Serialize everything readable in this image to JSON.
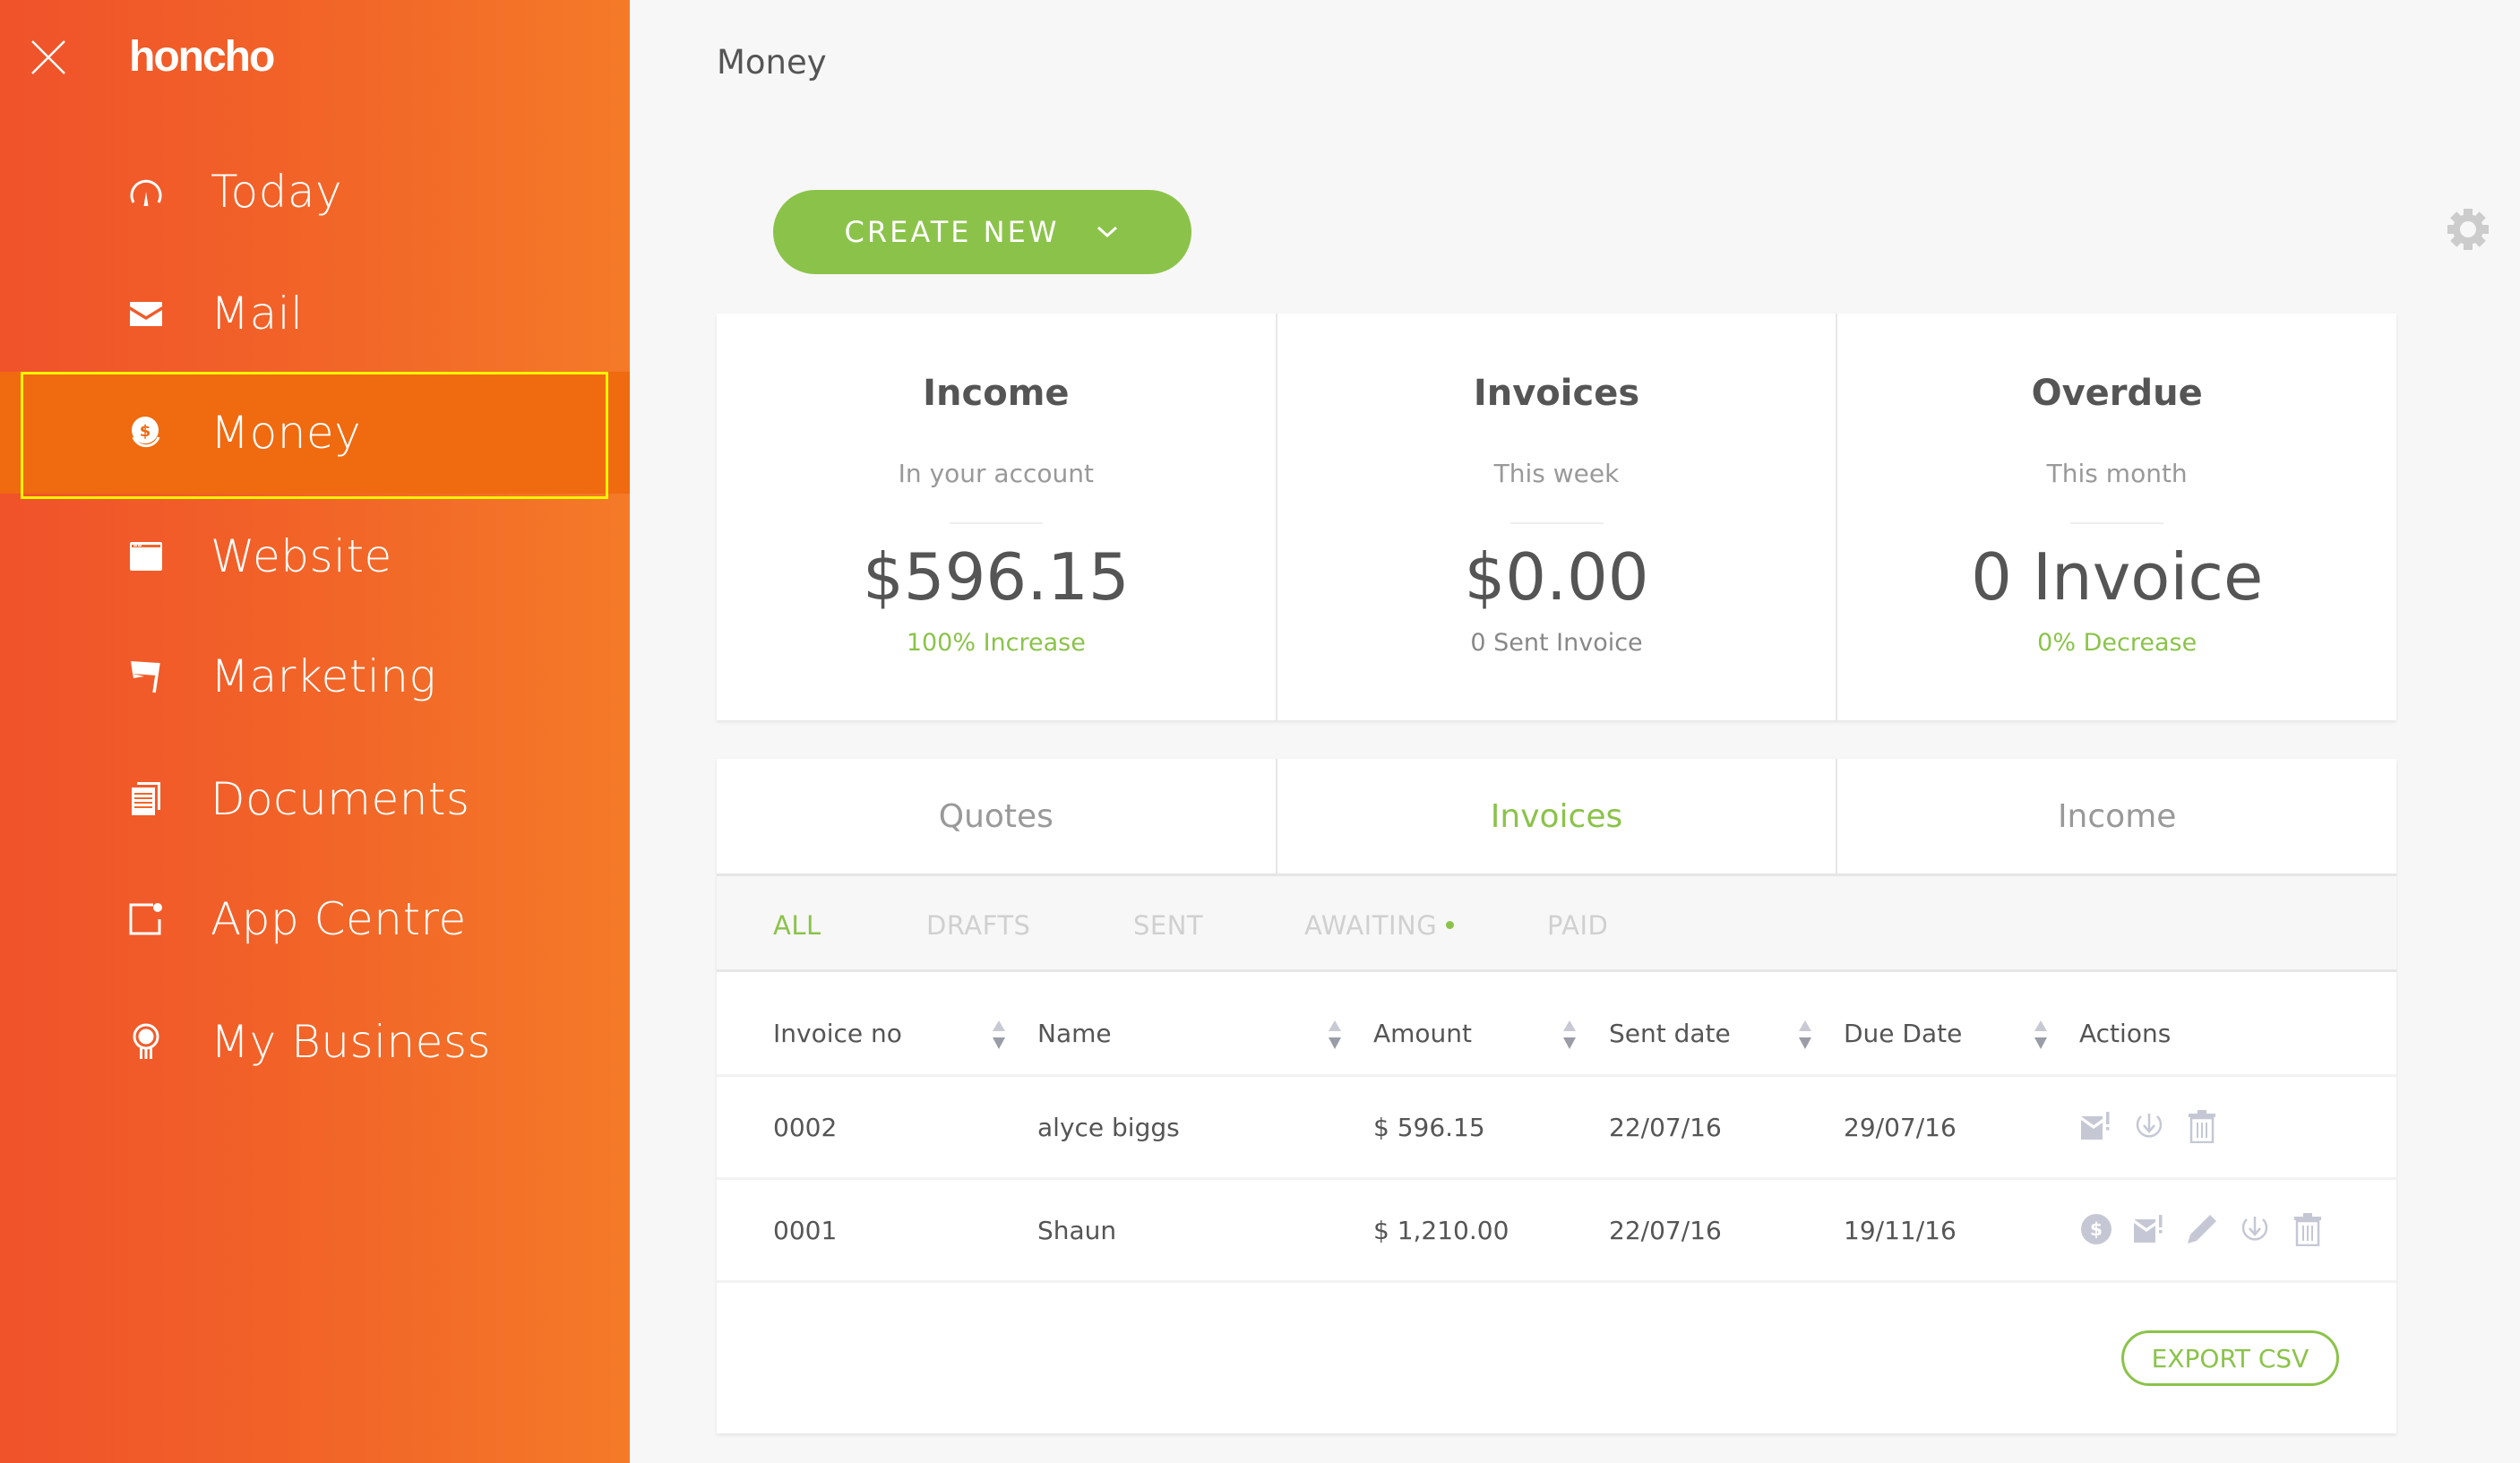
{
  "app": {
    "logo": "honcho",
    "close_icon": "close-icon"
  },
  "sidebar": {
    "items": [
      {
        "label": "Today",
        "icon": "gauge-icon",
        "active": false
      },
      {
        "label": "Mail",
        "icon": "envelope-icon",
        "active": false
      },
      {
        "label": "Money",
        "icon": "money-icon",
        "active": true
      },
      {
        "label": "Website",
        "icon": "browser-window-icon",
        "active": false
      },
      {
        "label": "Marketing",
        "icon": "flag-icon",
        "active": false
      },
      {
        "label": "Documents",
        "icon": "documents-icon",
        "active": false
      },
      {
        "label": "App Centre",
        "icon": "app-centre-icon",
        "active": false
      },
      {
        "label": "My Business",
        "icon": "award-ribbon-icon",
        "active": false
      }
    ]
  },
  "header": {
    "title": "Money",
    "create_label": "CREATE NEW",
    "settings_icon": "gear-icon"
  },
  "stats": [
    {
      "title": "Income",
      "subtitle": "In your account",
      "value": "$596.15",
      "note": "100% Increase",
      "note_color": "green"
    },
    {
      "title": "Invoices",
      "subtitle": "This week",
      "value": "$0.00",
      "note": "0 Sent Invoice",
      "note_color": "grey"
    },
    {
      "title": "Overdue",
      "subtitle": "This month",
      "value": "0 Invoice",
      "note": "0% Decrease",
      "note_color": "green"
    }
  ],
  "tabs": [
    {
      "label": "Quotes",
      "active": false
    },
    {
      "label": "Invoices",
      "active": true
    },
    {
      "label": "Income",
      "active": false
    }
  ],
  "filters": [
    {
      "label": "ALL",
      "active": true
    },
    {
      "label": "DRAFTS",
      "active": false
    },
    {
      "label": "SENT",
      "active": false
    },
    {
      "label": "AWAITING",
      "active": false,
      "has_dot": true
    },
    {
      "label": "PAID",
      "active": false
    }
  ],
  "table": {
    "columns": [
      "Invoice no",
      "Name",
      "Amount",
      "Sent date",
      "Due Date",
      "Actions"
    ],
    "rows": [
      {
        "invoice_no": "0002",
        "name": "alyce biggs",
        "amount": "$ 596.15",
        "sent_date": "22/07/16",
        "due_date": "29/07/16",
        "actions": [
          "send-reminder",
          "download",
          "delete"
        ]
      },
      {
        "invoice_no": "0001",
        "name": "Shaun",
        "amount": "$ 1,210.00",
        "sent_date": "22/07/16",
        "due_date": "19/11/16",
        "actions": [
          "mark-paid",
          "send-reminder",
          "edit",
          "download",
          "delete"
        ]
      }
    ]
  },
  "export_label": "EXPORT CSV",
  "colors": {
    "accent_green": "#8bc34a",
    "sidebar_start": "#f0522a",
    "sidebar_end": "#f47a28",
    "active_highlight": "#f9f400",
    "icon_grey": "#c5c8d4"
  }
}
